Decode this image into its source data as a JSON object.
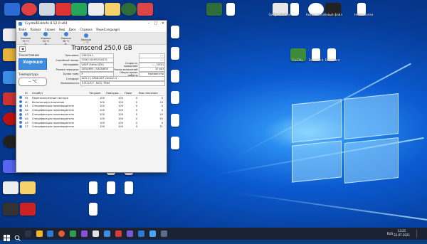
{
  "window": {
    "title": "CrystalDiskInfo 8.12.0 x64",
    "menu": [
      "Файл",
      "Правка",
      "Сервис",
      "Вид",
      "Диск",
      "Справка",
      "Язык(Language)"
    ],
    "temps": [
      {
        "status": "Хорошо",
        "temp": "35 °C",
        "drive": "C:"
      },
      {
        "status": "Хорошо",
        "temp": "34 °C",
        "drive": "D:"
      },
      {
        "status": "Хорошо",
        "temp": "38 °C",
        "drive": "E:"
      },
      {
        "status": "Хорошо",
        "temp": "-- °C",
        "drive": ""
      }
    ],
    "drive_title": "Transcend 250,0 GB",
    "health_label": "Техсостояние",
    "health_value": "Хорошо",
    "health_percent": "",
    "temp_label": "Температура",
    "temp_value": "-- °C",
    "info_left": [
      {
        "k": "Прошивка",
        "v": "230524-1"
      },
      {
        "k": "Серийный номер",
        "v": "I33A21S4HS2GA231"
      },
      {
        "k": "Интерфейс",
        "v": "UASP (Serial ATA)"
      },
      {
        "k": "Режим передачи",
        "v": "SATA/600 | SATA/600"
      },
      {
        "k": "Буква тома",
        "v": "F:"
      }
    ],
    "info_right": [
      {
        "k": "",
        "v": "----"
      },
      {
        "k": "",
        "v": "----"
      },
      {
        "k": "Скорость вращения",
        "v": "---- (SSD)"
      },
      {
        "k": "Число включений",
        "v": "10 раз"
      },
      {
        "k": "Общее время работы",
        "v": "Неизвестно"
      }
    ],
    "standard_label": "Стандарт",
    "standard_value": "ACS-2 | ATA8-ACS version 4",
    "features_label": "Возможности",
    "features_value": "S.M.A.R.T., NCQ, TRIM",
    "smart_headers": [
      "ID",
      "Атрибут",
      "Текущее",
      "Наихудш...",
      "Порог",
      "Raw-значения"
    ],
    "smart_rows": [
      {
        "id": "05",
        "name": "Переназначенные сектора",
        "cur": "100",
        "worst": "100",
        "thr": "0",
        "raw": "0"
      },
      {
        "id": "0C",
        "name": "Включения/отключения",
        "cur": "100",
        "worst": "100",
        "thr": "0",
        "raw": "10"
      },
      {
        "id": "A1",
        "name": "Спецификация производителя",
        "cur": "100",
        "worst": "100",
        "thr": "0",
        "raw": "0"
      },
      {
        "id": "A2",
        "name": "Спецификация производителя",
        "cur": "100",
        "worst": "100",
        "thr": "0",
        "raw": "0"
      },
      {
        "id": "A3",
        "name": "Спецификация производителя",
        "cur": "100",
        "worst": "100",
        "thr": "0",
        "raw": "10"
      },
      {
        "id": "A4",
        "name": "Спецификация производителя",
        "cur": "100",
        "worst": "100",
        "thr": "0",
        "raw": "55"
      },
      {
        "id": "A5",
        "name": "Спецификация производителя",
        "cur": "100",
        "worst": "100",
        "thr": "0",
        "raw": "0"
      },
      {
        "id": "C7",
        "name": "Спецификация производителя",
        "cur": "100",
        "worst": "100",
        "thr": "0",
        "raw": "31"
      }
    ]
  },
  "desktop_labels": {
    "right_top": [
      "Google Chrome",
      "Новая папка",
      "Новый файл",
      "Новая папка"
    ],
    "right_mid": [
      "FileZilla",
      "Document",
      "Document"
    ]
  },
  "taskbar": {
    "lang": "RUS",
    "time": "13:21",
    "date": "22.07.2021"
  }
}
